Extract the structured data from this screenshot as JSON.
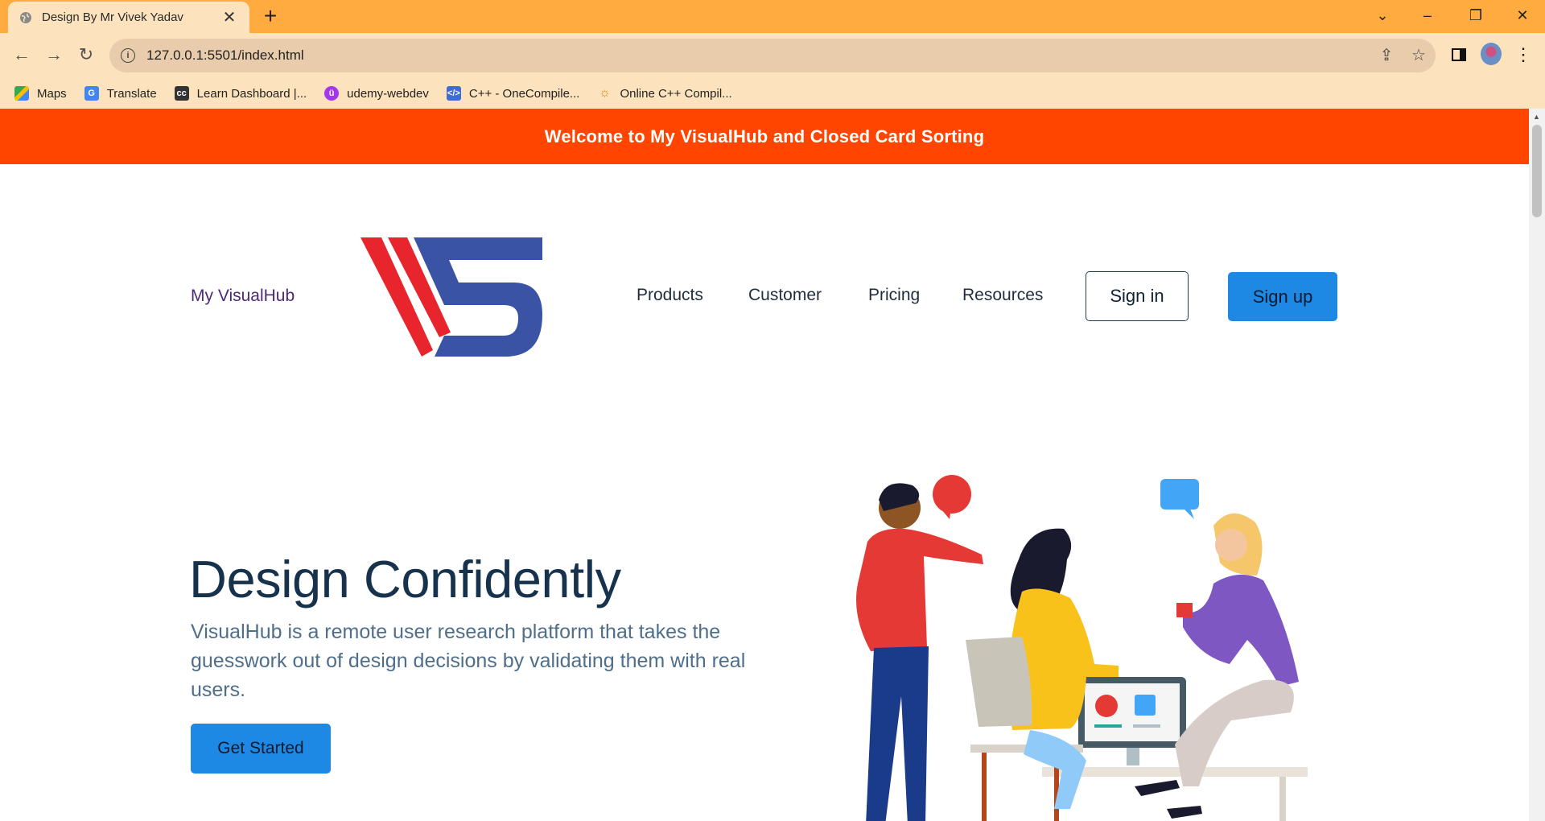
{
  "browser": {
    "tab_title": "Design By Mr Vivek Yadav",
    "url": "127.0.0.1:5501/index.html",
    "bookmarks": [
      {
        "label": "Maps",
        "icon": "maps-icon"
      },
      {
        "label": "Translate",
        "icon": "translate-icon"
      },
      {
        "label": "Learn Dashboard |...",
        "icon": "coursera-icon"
      },
      {
        "label": "udemy-webdev",
        "icon": "udemy-icon"
      },
      {
        "label": "C++ - OneCompile...",
        "icon": "code-icon"
      },
      {
        "label": "Online C++ Compil...",
        "icon": "sun-icon"
      }
    ]
  },
  "page": {
    "banner": "Welcome to My VisualHub and Closed Card Sorting",
    "brand": "My VisualHub",
    "nav": [
      "Products",
      "Customer",
      "Pricing",
      "Resources"
    ],
    "signin": "Sign in",
    "signup": "Sign up",
    "hero": {
      "title": "Design Confidently",
      "text": "VisualHub is a remote user research platform that takes the guesswork out of design decisions by validating them with real users.",
      "cta": "Get Started"
    }
  },
  "colors": {
    "tab_strip": "#ffab40",
    "banner": "#ff4500",
    "primary_button": "#1e88e5",
    "heading": "#17324d"
  }
}
